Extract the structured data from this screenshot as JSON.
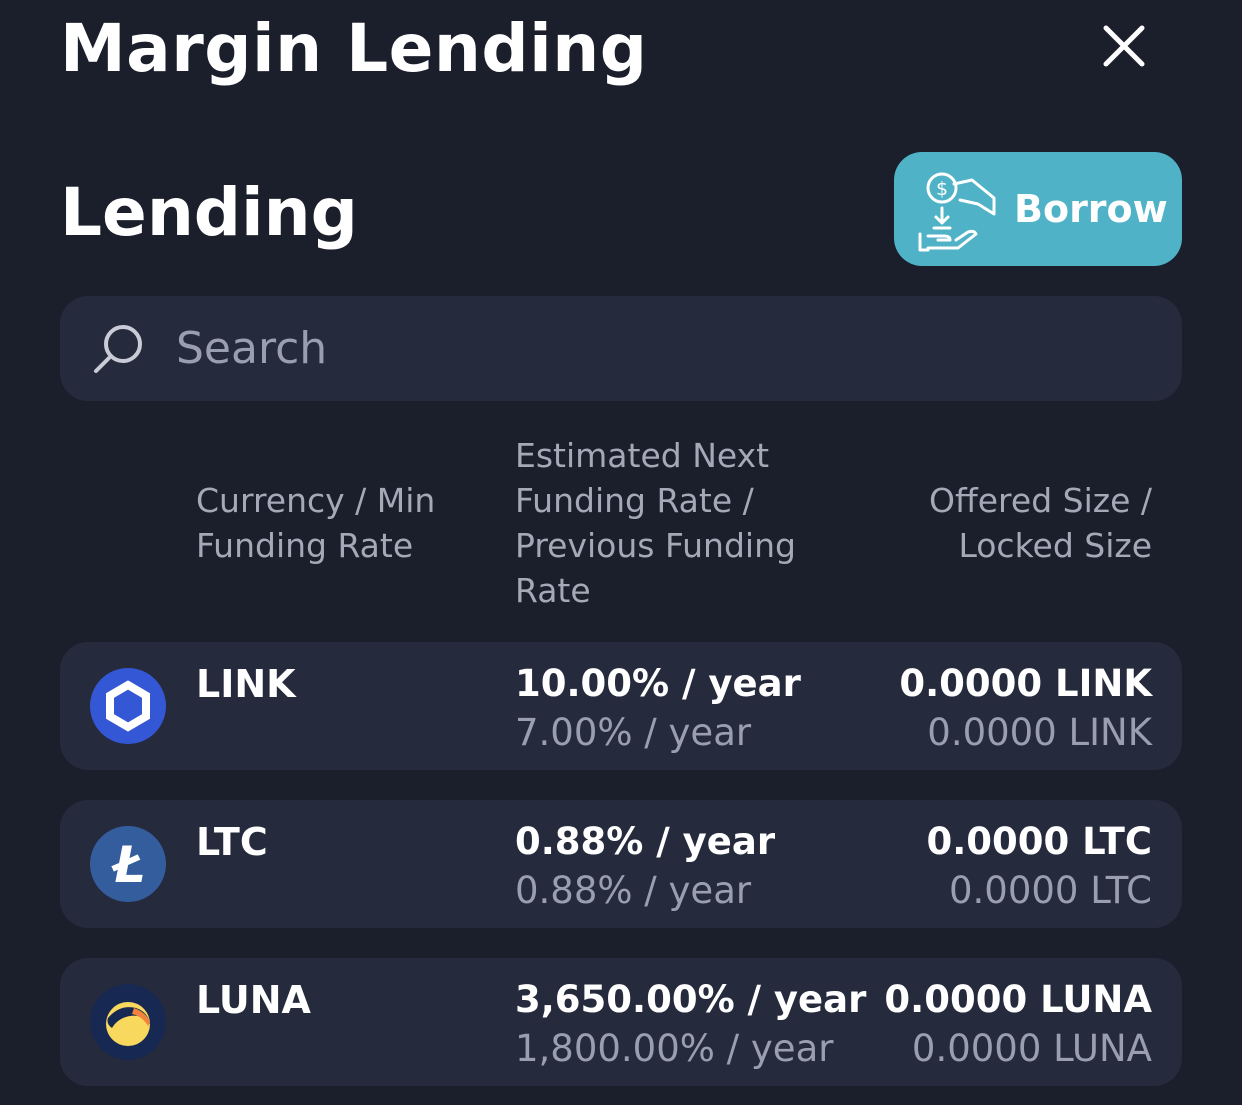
{
  "header": {
    "title": "Margin Lending",
    "close_icon": "close-icon"
  },
  "section": {
    "title": "Lending"
  },
  "borrow_button": {
    "label": "Borrow",
    "icon": "borrow-hand-coin-icon",
    "color": "#4fb2c6"
  },
  "search": {
    "placeholder": "Search",
    "value": "",
    "icon": "search-icon"
  },
  "columns": [
    {
      "label": "Currency / Min Funding Rate"
    },
    {
      "label": "Estimated Next Funding Rate / Previous Funding Rate"
    },
    {
      "label": "Offered Size / Locked Size"
    }
  ],
  "rows": [
    {
      "symbol": "LINK",
      "icon": "chainlink-icon",
      "icon_color": "#3457d5",
      "next_rate": "10.00% / year",
      "prev_rate": "7.00% / year",
      "offered_size": "0.0000 LINK",
      "locked_size": "0.0000 LINK"
    },
    {
      "symbol": "LTC",
      "icon": "litecoin-icon",
      "icon_color": "#345d9d",
      "next_rate": "0.88% / year",
      "prev_rate": "0.88% / year",
      "offered_size": "0.0000 LTC",
      "locked_size": "0.0000 LTC"
    },
    {
      "symbol": "LUNA",
      "icon": "terra-luna-icon",
      "icon_color": "#172852",
      "next_rate": "3,650.00% / year",
      "prev_rate": "1,800.00% / year",
      "offered_size": "0.0000 LUNA",
      "locked_size": "0.0000 LUNA"
    }
  ],
  "colors": {
    "background": "#1b1e2b",
    "card": "#262a3d",
    "muted_text": "#9a9fb0"
  }
}
